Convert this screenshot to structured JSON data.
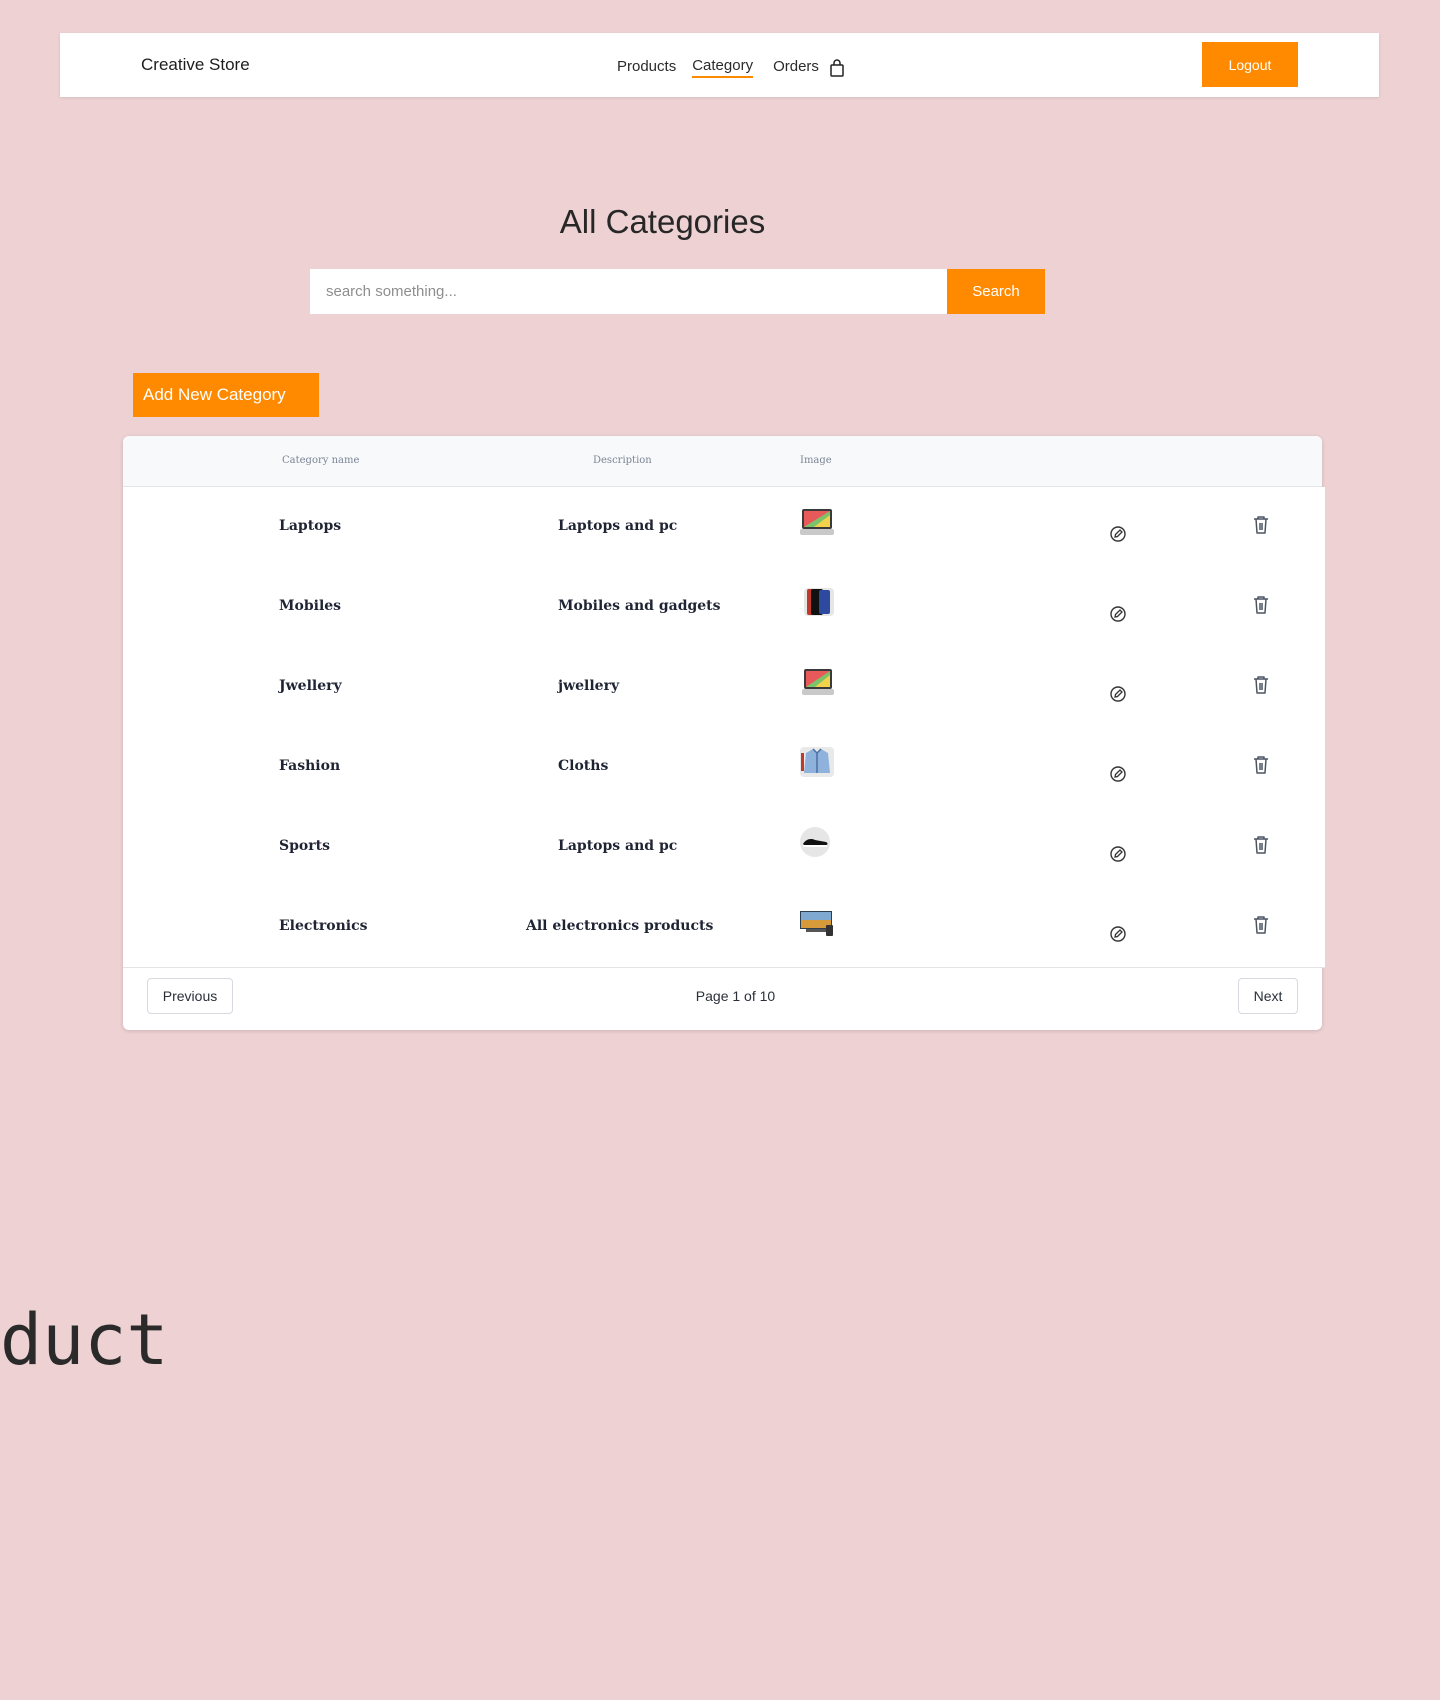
{
  "navbar": {
    "brand": "Creative Store",
    "links": [
      {
        "label": "Products",
        "active": false
      },
      {
        "label": "Category",
        "active": true
      },
      {
        "label": "Orders",
        "active": false
      }
    ],
    "cart_icon": "shopping-bag-icon",
    "logout_label": "Logout"
  },
  "page": {
    "title": "All Categories"
  },
  "search": {
    "placeholder": "search something...",
    "value": "",
    "button_label": "Search"
  },
  "add_button_label": "Add New Category",
  "table": {
    "headers": {
      "name": "Category name",
      "description": "Description",
      "image": "Image"
    },
    "rows": [
      {
        "name": "Laptops",
        "description": "Laptops and pc",
        "image_icon": "laptop-thumbnail"
      },
      {
        "name": "Mobiles",
        "description": "Mobiles and gadgets",
        "image_icon": "mobile-thumbnail"
      },
      {
        "name": "Jwellery",
        "description": "jwellery",
        "image_icon": "laptop-thumbnail"
      },
      {
        "name": "Fashion",
        "description": "Cloths",
        "image_icon": "jacket-thumbnail"
      },
      {
        "name": "Sports",
        "description": "Laptops and pc",
        "image_icon": "shoe-thumbnail"
      },
      {
        "name": "Electronics",
        "description": "All electronics products",
        "image_icon": "tv-thumbnail"
      }
    ],
    "row_actions": {
      "edit_icon": "edit-icon",
      "delete_icon": "trash-icon"
    }
  },
  "pagination": {
    "previous_label": "Previous",
    "page_text": "Page 1 of 10",
    "next_label": "Next"
  },
  "stray_text": "duct",
  "colors": {
    "background": "#edd1d3",
    "accent": "#ff8a00",
    "surface": "#ffffff",
    "table_header_bg": "#f8f9fb",
    "text_dark": "#1f2433"
  }
}
